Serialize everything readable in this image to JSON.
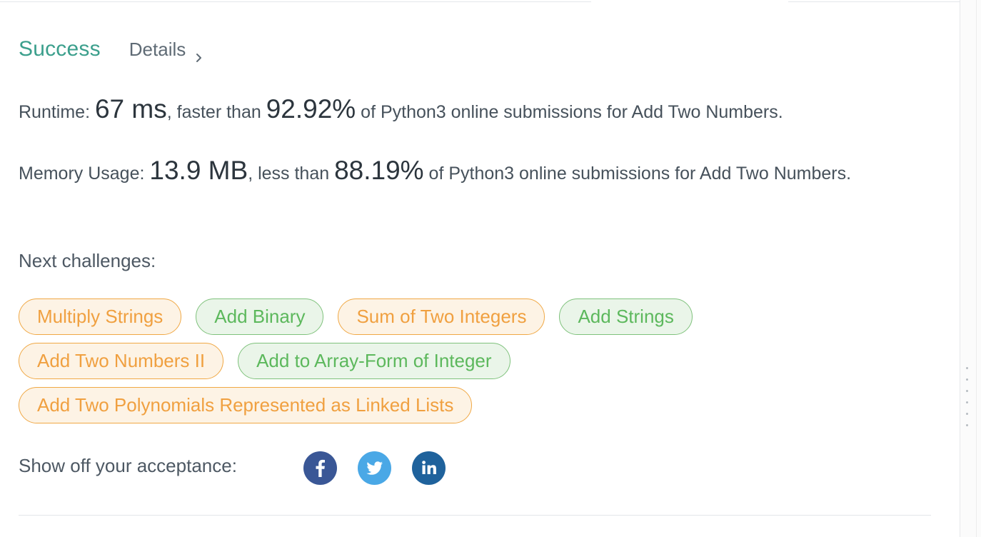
{
  "status": {
    "label": "Success",
    "details_label": "Details",
    "color": "#3b9f8c"
  },
  "runtime": {
    "prefix": "Runtime: ",
    "value": "67 ms",
    "mid": ", faster than ",
    "percent": "92.92%",
    "suffix": " of Python3 online submissions for Add Two Numbers."
  },
  "memory": {
    "prefix": "Memory Usage: ",
    "value": "13.9 MB",
    "mid": ", less than ",
    "percent": "88.19%",
    "suffix": " of Python3 online submissions for Add Two Numbers."
  },
  "next_challenges": {
    "label": "Next challenges:",
    "items": [
      {
        "label": "Multiply Strings",
        "difficulty": "medium"
      },
      {
        "label": "Add Binary",
        "difficulty": "easy"
      },
      {
        "label": "Sum of Two Integers",
        "difficulty": "medium"
      },
      {
        "label": "Add Strings",
        "difficulty": "easy"
      },
      {
        "label": "Add Two Numbers II",
        "difficulty": "medium"
      },
      {
        "label": "Add to Array-Form of Integer",
        "difficulty": "easy"
      },
      {
        "label": "Add Two Polynomials Represented as Linked Lists",
        "difficulty": "medium"
      }
    ]
  },
  "share": {
    "label": "Show off your acceptance:",
    "icons": [
      "facebook-icon",
      "twitter-icon",
      "linkedin-icon"
    ]
  },
  "colors": {
    "medium_text": "#f0a040",
    "medium_bg": "#fdf3e5",
    "easy_text": "#5cb85c",
    "easy_bg": "#eaf5e9",
    "facebook": "#3a5796",
    "twitter": "#4aa8e6",
    "linkedin": "#1f629c"
  }
}
